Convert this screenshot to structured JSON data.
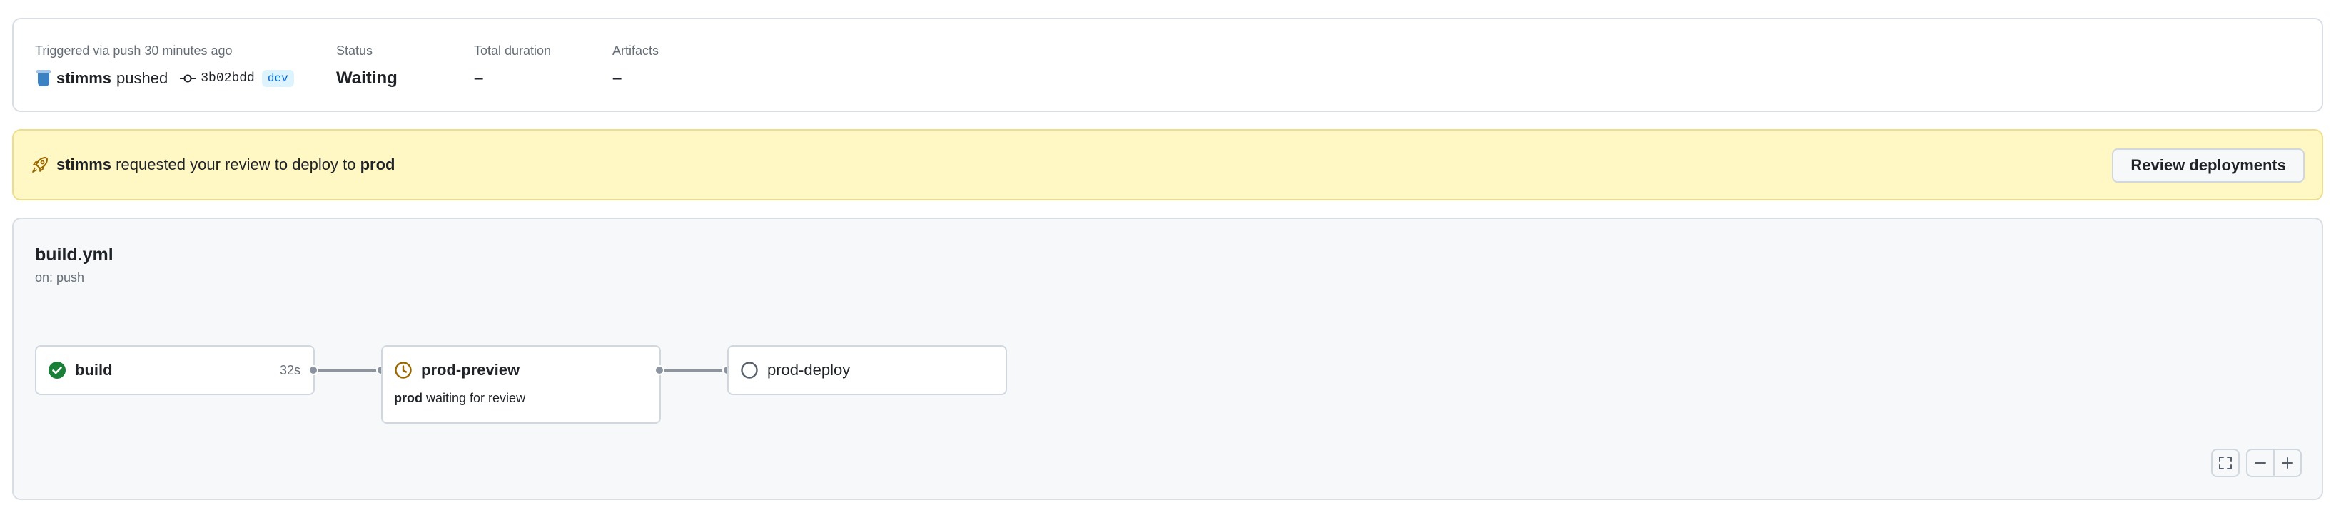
{
  "summary": {
    "trigger_label": "Triggered via push 30 minutes ago",
    "push_user": "stimms",
    "push_action": "pushed",
    "commit_sha": "3b02bdd",
    "branch": "dev",
    "status_label": "Status",
    "status_value": "Waiting",
    "duration_label": "Total duration",
    "duration_value": "–",
    "artifacts_label": "Artifacts",
    "artifacts_value": "–"
  },
  "banner": {
    "user": "stimms",
    "text": "requested your review to deploy to",
    "environment": "prod",
    "button_label": "Review deployments",
    "background_color": "#fff8c5"
  },
  "workflow": {
    "file": "build.yml",
    "trigger": "on: push",
    "jobs": [
      {
        "name": "build",
        "status": "success",
        "duration": "32s",
        "icon": "check-circle-icon"
      },
      {
        "name": "prod-preview",
        "status": "waiting",
        "env": "prod",
        "note": "waiting for review",
        "icon": "clock-icon"
      },
      {
        "name": "prod-deploy",
        "status": "pending",
        "icon": "circle-icon"
      }
    ]
  },
  "colors": {
    "success": "#1a7f37",
    "waiting": "#9a6700",
    "pending": "#57606a",
    "link": "#0969da"
  }
}
